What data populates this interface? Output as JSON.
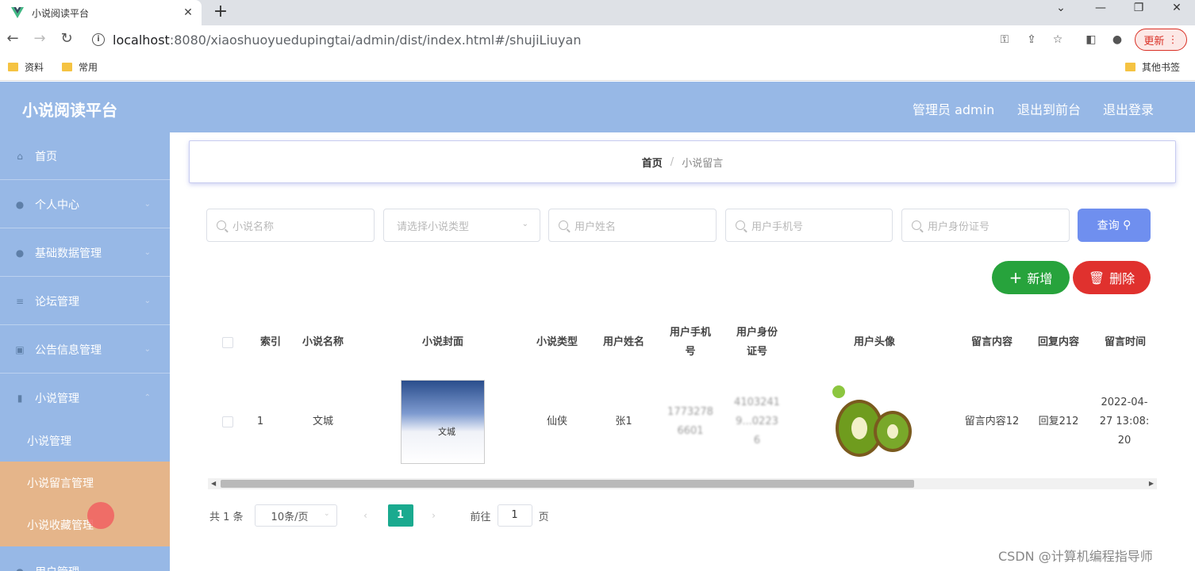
{
  "browser": {
    "tab_title": "小说阅读平台",
    "url_host": "localhost",
    "url_rest": ":8080/xiaoshuoyuedupingtai/admin/dist/index.html#/shujiLiuyan",
    "update_label": "更新",
    "bookmarks": [
      "资料",
      "常用"
    ],
    "other_bookmarks": "其他书签"
  },
  "app": {
    "title": "小说阅读平台",
    "header_links": [
      "管理员 admin",
      "退出到前台",
      "退出登录"
    ]
  },
  "sidebar": {
    "items": [
      {
        "label": "首页",
        "icon": "home-icon"
      },
      {
        "label": "个人中心",
        "icon": "user-icon"
      },
      {
        "label": "基础数据管理",
        "icon": "user-icon"
      },
      {
        "label": "论坛管理",
        "icon": "list-icon"
      },
      {
        "label": "公告信息管理",
        "icon": "bag-icon"
      },
      {
        "label": "小说管理",
        "icon": "book-icon"
      }
    ],
    "sub_items": [
      "小说管理",
      "小说留言管理",
      "小说收藏管理"
    ],
    "next_item": "用户管理"
  },
  "breadcrumb": {
    "home": "首页",
    "sep": "/",
    "current": "小说留言"
  },
  "search": {
    "novel_name_placeholder": "小说名称",
    "novel_type_placeholder": "请选择小说类型",
    "user_name_placeholder": "用户姓名",
    "user_phone_placeholder": "用户手机号",
    "user_id_placeholder": "用户身份证号",
    "query_label": "查询"
  },
  "actions": {
    "add_label": "新增",
    "delete_label": "删除"
  },
  "table": {
    "headers": [
      "索引",
      "小说名称",
      "小说封面",
      "小说类型",
      "用户姓名",
      "用户手机号",
      "用户身份证号",
      "用户头像",
      "留言内容",
      "回复内容",
      "留言时间"
    ],
    "rows": [
      {
        "index": "1",
        "novel_name": "文城",
        "cover_text": "文城",
        "novel_type": "仙侠",
        "user_name": "张1",
        "user_phone": "1773278 6601",
        "user_id": "4103241 9...0223 6",
        "message": "留言内容12",
        "reply": "回复212",
        "time": "2022-04-27 13:08:20"
      }
    ]
  },
  "pagination": {
    "total": "共 1 条",
    "page_size": "10条/页",
    "current_page": "1",
    "goto_prefix": "前往",
    "goto_value": "1",
    "goto_suffix": "页"
  },
  "watermark": "CSDN @计算机编程指导师",
  "colors": {
    "header_bg": "#97b8e6",
    "active_menu": "#e5b58a",
    "query_btn": "#6f8fef",
    "add_btn": "#27a33c",
    "delete_btn": "#e0312e",
    "page_active": "#1aaa8f"
  }
}
